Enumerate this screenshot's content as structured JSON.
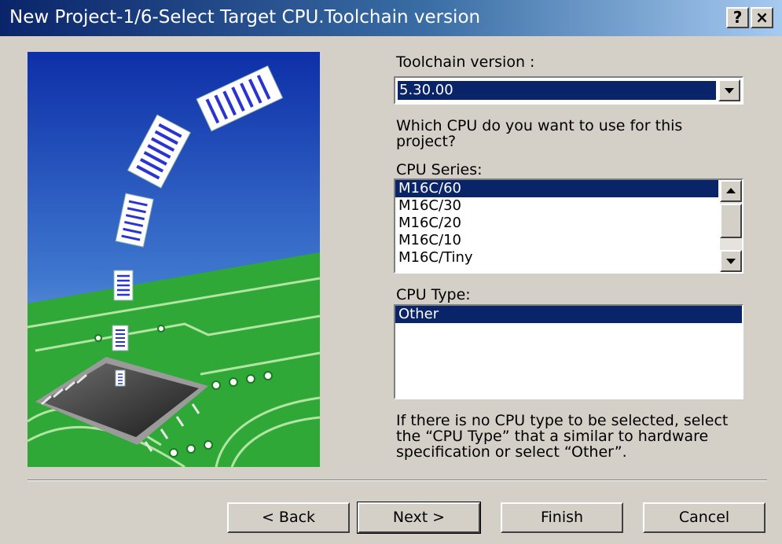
{
  "window": {
    "title": "New Project-1/6-Select Target CPU.Toolchain version",
    "help_label": "?",
    "close_label": "×"
  },
  "toolchain": {
    "label": "Toolchain version :",
    "selected": "5.30.00"
  },
  "question": "Which CPU do you want to use for this project?",
  "cpu_series": {
    "label": "CPU Series:",
    "items": [
      "M16C/60",
      "M16C/30",
      "M16C/20",
      "M16C/10",
      "M16C/Tiny"
    ],
    "selected_index": 0
  },
  "cpu_type": {
    "label": "CPU Type:",
    "items": [
      "Other"
    ],
    "selected_index": 0
  },
  "hint": "If there is no CPU type to be selected, select the “CPU Type” that a similar to hardware specification or select “Other”.",
  "buttons": {
    "back": "< Back",
    "next": "Next >",
    "finish": "Finish",
    "cancel": "Cancel"
  },
  "colors": {
    "titlebar": "#0a246a",
    "selection": "#0a246a",
    "dialog_bg": "#d4d0c8",
    "board_green": "#2fa838"
  }
}
